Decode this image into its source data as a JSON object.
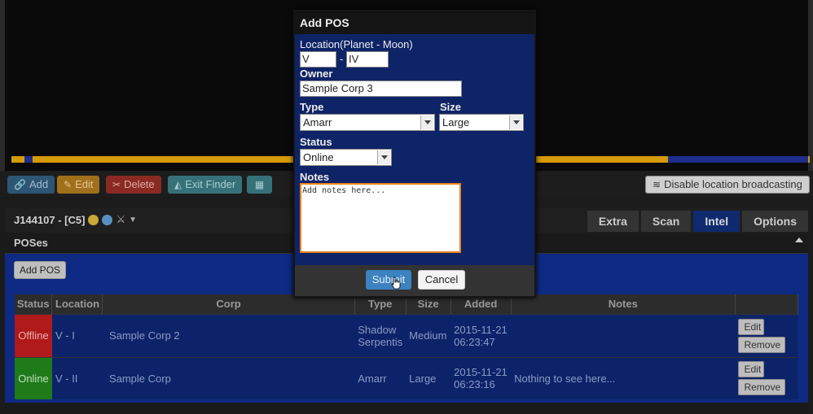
{
  "toolbar": {
    "add": "Add",
    "edit": "Edit",
    "delete": "Delete",
    "exit_finder": "Exit Finder",
    "disable_broadcast": "Disable location broadcasting"
  },
  "system": {
    "title": "J144107 - [C5]"
  },
  "tabs": [
    "Extra",
    "Scan",
    "Intel",
    "Options"
  ],
  "poses": {
    "title": "POSes",
    "add_button": "Add POS",
    "columns": [
      "Status",
      "Location",
      "Corp",
      "Type",
      "Size",
      "Added",
      "Notes"
    ],
    "rows": [
      {
        "status": "Offline",
        "location": "V - I",
        "corp": "Sample Corp 2",
        "type_line1": "Shadow",
        "type_line2": "Serpentis",
        "size": "Medium",
        "added_line1": "2015-11-21",
        "added_line2": "06:23:47",
        "notes": "",
        "edit": "Edit",
        "remove": "Remove"
      },
      {
        "status": "Online",
        "location": "V - II",
        "corp": "Sample Corp",
        "type_line1": "Amarr",
        "type_line2": "",
        "size": "Large",
        "added_line1": "2015-11-21",
        "added_line2": "06:23:16",
        "notes": "Nothing to see here...",
        "edit": "Edit",
        "remove": "Remove"
      }
    ]
  },
  "modal": {
    "title": "Add POS",
    "location_label": "Location(Planet - Moon)",
    "planet": "V",
    "dash": "-",
    "moon": "IV",
    "owner_label": "Owner",
    "owner": "Sample Corp 3",
    "type_label": "Type",
    "type": "Amarr",
    "size_label": "Size",
    "size": "Large",
    "status_label": "Status",
    "status": "Online",
    "notes_label": "Notes",
    "notes_placeholder": "Add notes here...",
    "submit": "Submit",
    "cancel": "Cancel"
  },
  "colors": {
    "offline": "#b01a1a",
    "online": "#1f7a1a",
    "accent_blue": "#3b82c0",
    "notes_focus": "#e8821e"
  }
}
